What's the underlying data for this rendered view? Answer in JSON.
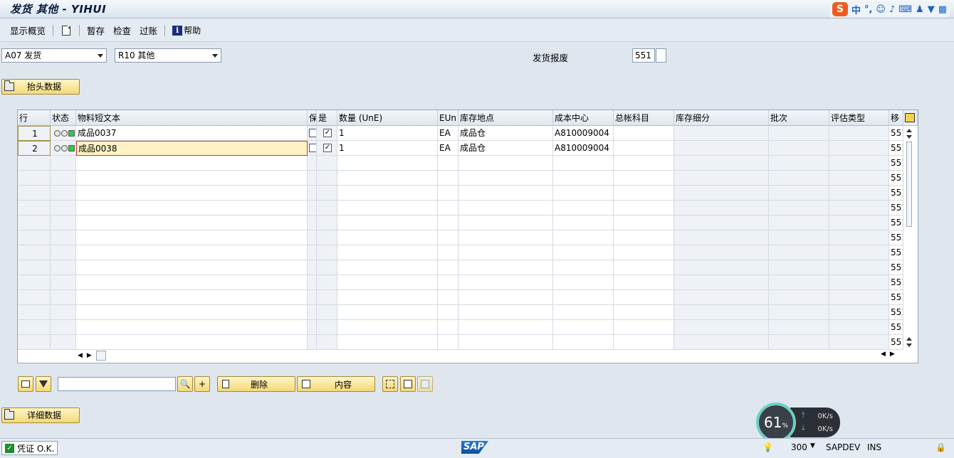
{
  "window": {
    "title": "发货 其他 - YIHUI"
  },
  "ime": {
    "lang": "中",
    "punct": "°,"
  },
  "toolbar": {
    "overview": "显示概览",
    "hold": "暂存",
    "check": "检查",
    "post": "过账",
    "help": "帮助"
  },
  "header": {
    "action": "A07 发货",
    "reference": "R10 其他",
    "movement_type_label": "发货报废",
    "movement_type": "551",
    "header_data_button": "抬头数据"
  },
  "table": {
    "columns": [
      "行",
      "状态",
      "物料短文本",
      "保",
      "是",
      "数量 (UnE)",
      "EUn",
      "库存地点",
      "成本中心",
      "总帐科目",
      "库存细分",
      "批次",
      "评估类型",
      "移"
    ],
    "rows": [
      {
        "line": "1",
        "material": "成品0037",
        "ok": "✓",
        "qty": "1",
        "unit": "EA",
        "sloc": "成品仓",
        "cost_center": "A810009004"
      },
      {
        "line": "2",
        "material": "成品0038",
        "ok": "✓",
        "qty": "1",
        "unit": "EA",
        "sloc": "成品仓",
        "cost_center": "A810009004"
      }
    ],
    "movement_col_value": "551"
  },
  "bottom_toolbar": {
    "delete": "删除",
    "content": "内容",
    "search_value": ""
  },
  "detail_button": "详细数据",
  "status": {
    "message": "凭证 O.K.",
    "client": "300",
    "system": "SAPDEV",
    "mode": "INS"
  },
  "widget": {
    "percent": "61",
    "up": "0K/s",
    "down": "0K/s"
  },
  "colors": {
    "accent": "#f4d879",
    "grid_header": "#dfe6ee",
    "ok_green": "#1b8d2c"
  }
}
